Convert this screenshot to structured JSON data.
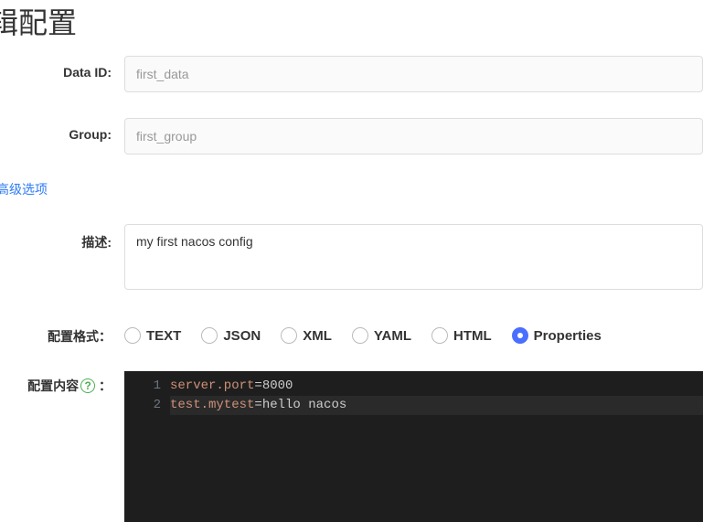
{
  "title": "辑配置",
  "fields": {
    "dataId": {
      "label": "Data ID:",
      "value": "first_data"
    },
    "group": {
      "label": "Group:",
      "value": "first_group"
    },
    "description": {
      "label": "描述:",
      "value": "my first nacos config"
    },
    "format": {
      "label": "配置格式："
    },
    "content": {
      "label": "配置内容",
      "colon": "："
    }
  },
  "advancedLink": "高级选项",
  "formats": [
    {
      "key": "text",
      "label": "TEXT",
      "selected": false
    },
    {
      "key": "json",
      "label": "JSON",
      "selected": false
    },
    {
      "key": "xml",
      "label": "XML",
      "selected": false
    },
    {
      "key": "yaml",
      "label": "YAML",
      "selected": false
    },
    {
      "key": "html",
      "label": "HTML",
      "selected": false
    },
    {
      "key": "properties",
      "label": "Properties",
      "selected": true
    }
  ],
  "code": {
    "lines": [
      {
        "n": "1",
        "key": "server.port",
        "val": "8000",
        "current": false
      },
      {
        "n": "2",
        "key": "test.mytest",
        "val": "hello nacos",
        "current": true
      }
    ]
  },
  "helpGlyph": "?"
}
